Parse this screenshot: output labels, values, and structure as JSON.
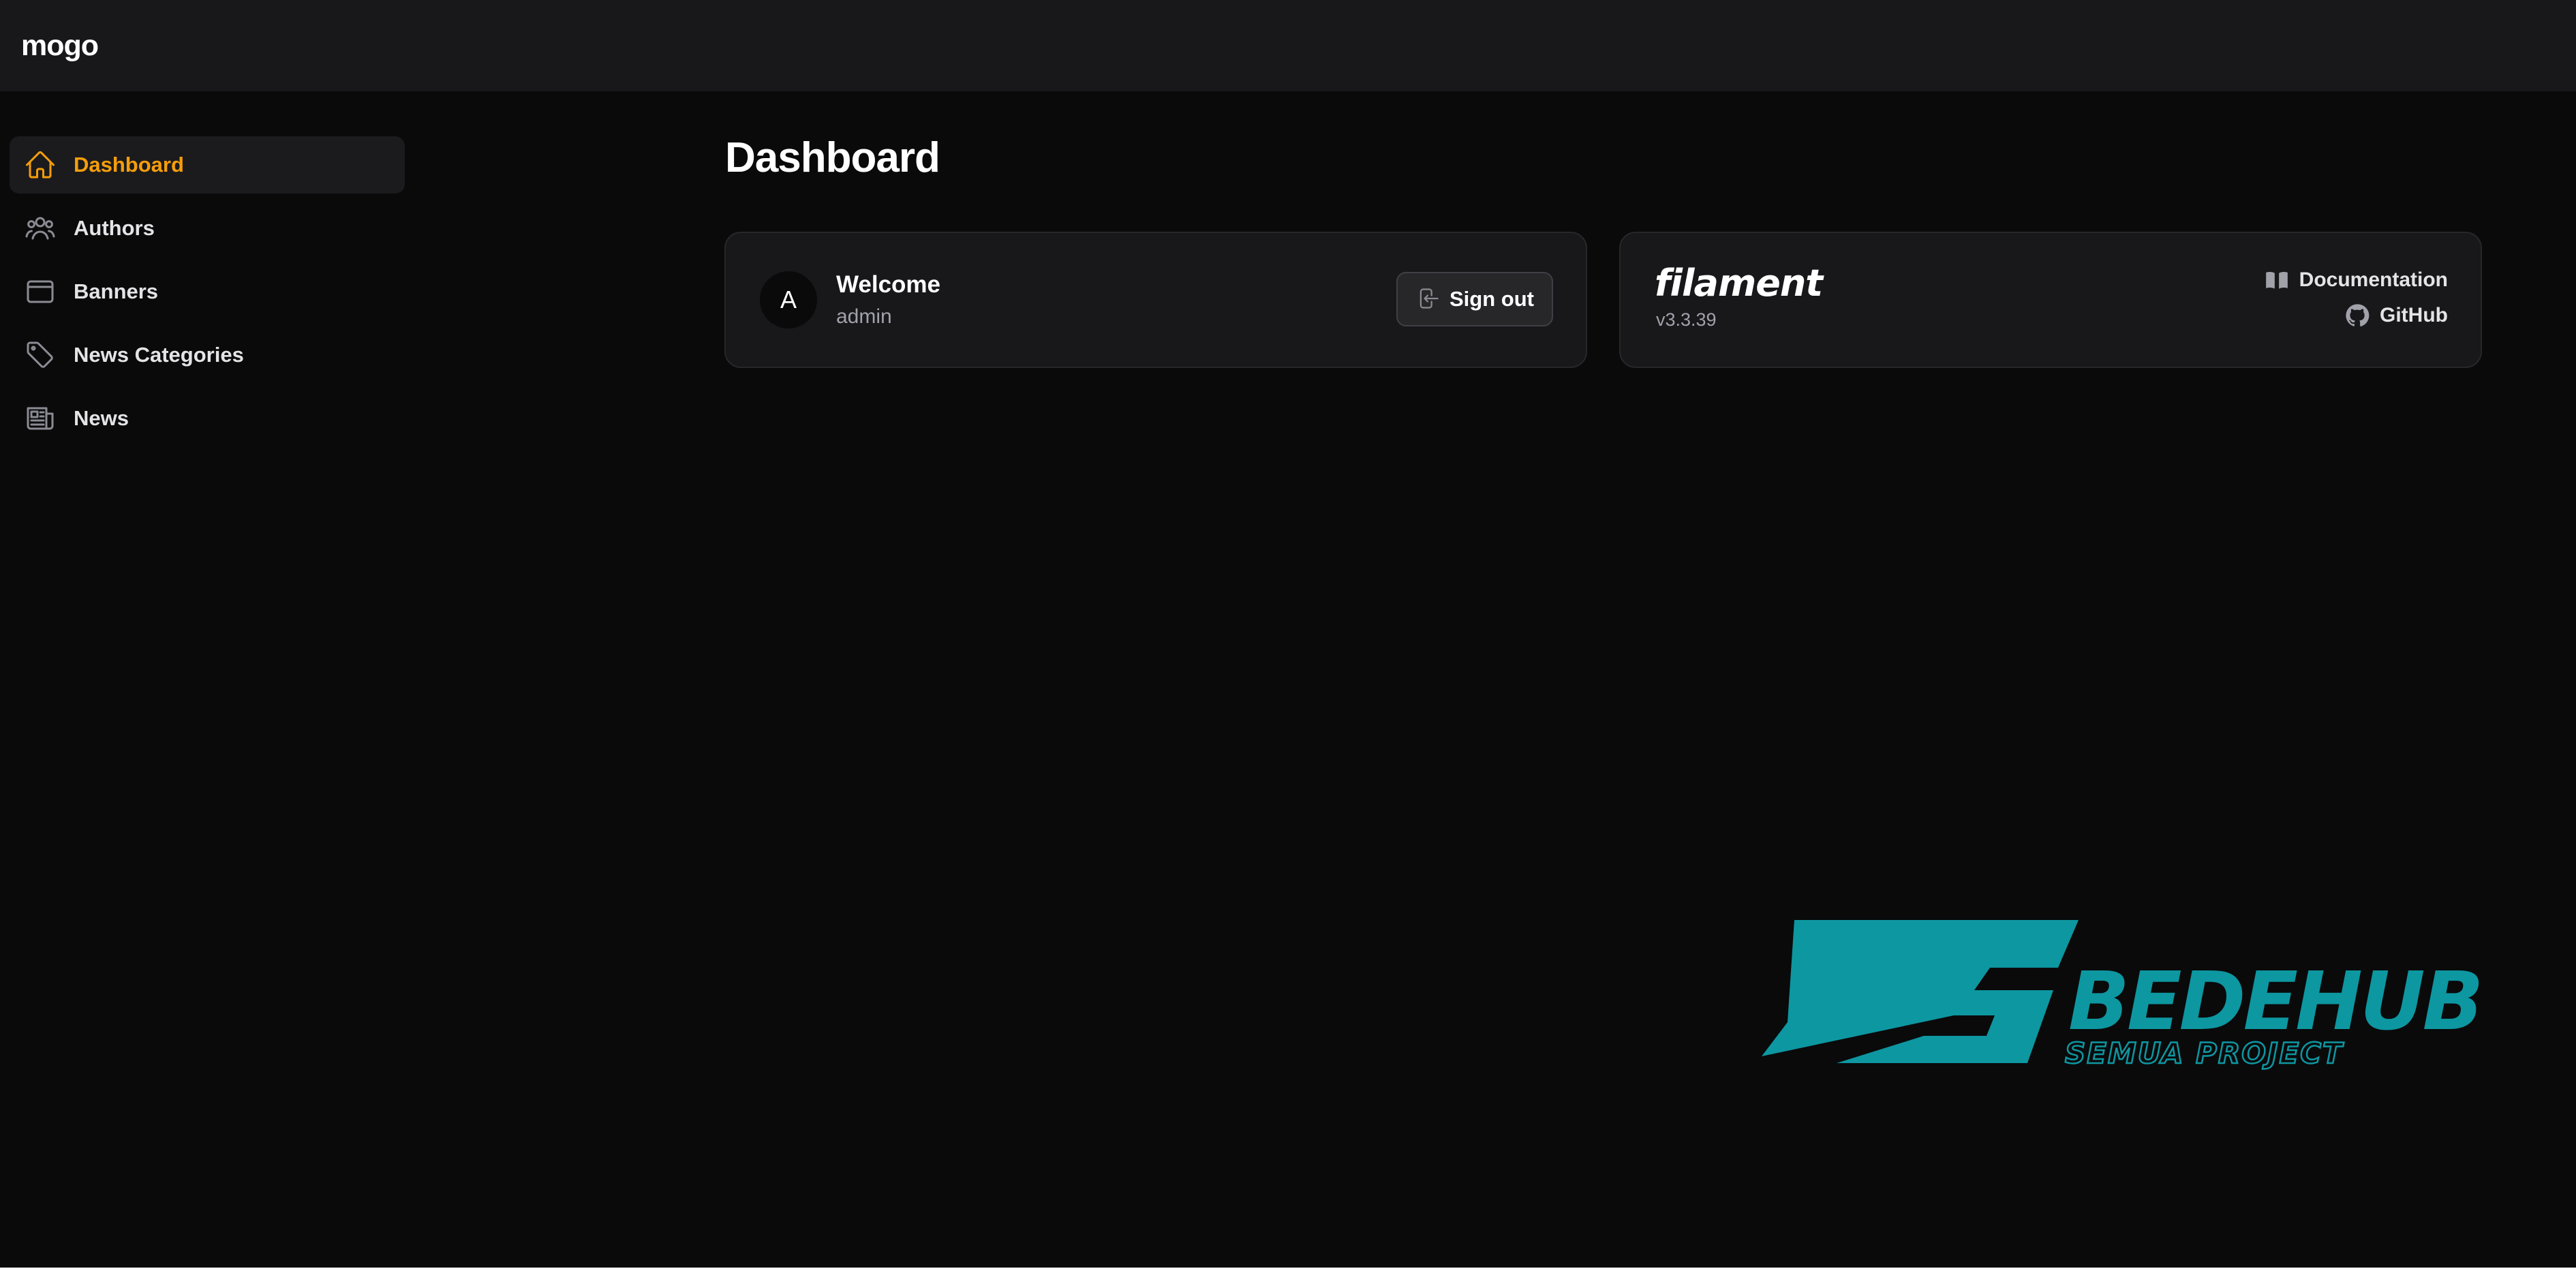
{
  "app": {
    "brand": "mogo"
  },
  "sidebar": {
    "items": [
      {
        "label": "Dashboard",
        "icon": "home-icon",
        "active": true
      },
      {
        "label": "Authors",
        "icon": "users-icon"
      },
      {
        "label": "Banners",
        "icon": "window-icon"
      },
      {
        "label": "News Categories",
        "icon": "tag-icon"
      },
      {
        "label": "News",
        "icon": "newspaper-icon"
      }
    ]
  },
  "main": {
    "title": "Dashboard",
    "welcome": {
      "avatar_initial": "A",
      "title": "Welcome",
      "username": "admin",
      "signout_label": "Sign out",
      "signout_icon": "logout-icon"
    },
    "filament": {
      "logo_text": "filament",
      "version": "v3.3.39",
      "documentation_label": "Documentation",
      "documentation_icon": "book-icon",
      "github_label": "GitHub",
      "github_icon": "github-icon"
    }
  },
  "watermark": {
    "title": "BEDEHUB",
    "subtitle": "SEMUA PROJECT",
    "color": "#0d97a1"
  },
  "colors": {
    "accent": "#f59e0b",
    "background": "#0a0a0b",
    "topbar": "#18181b",
    "card": "#18181b"
  }
}
